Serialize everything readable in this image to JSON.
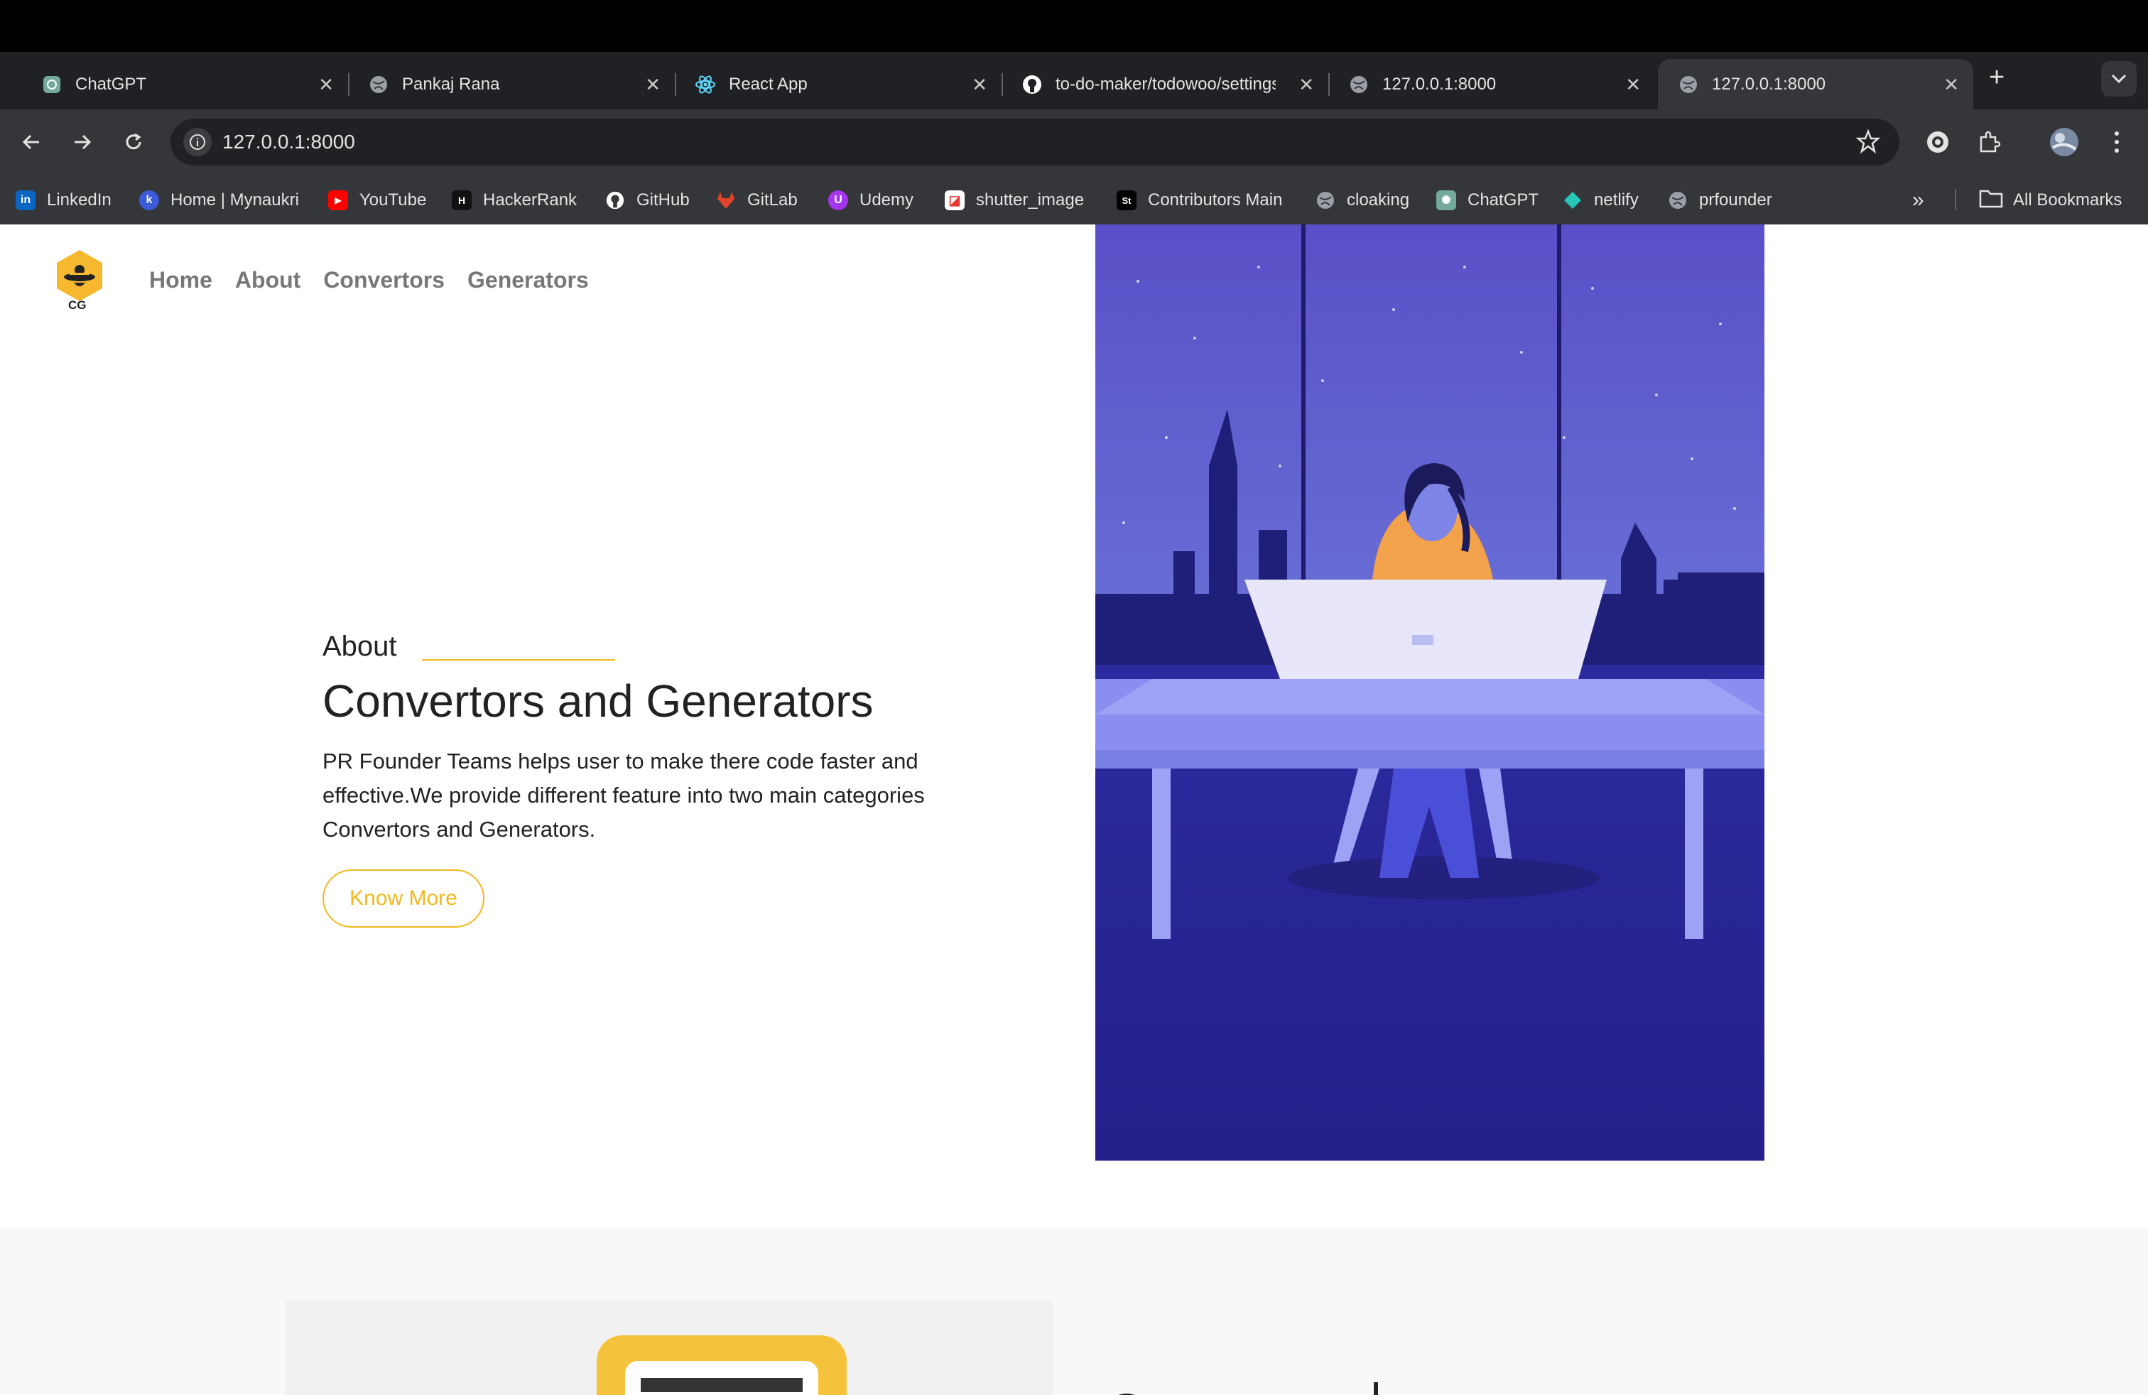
{
  "browser": {
    "tabs": [
      {
        "title": "ChatGPT",
        "icon": "chatgpt-icon",
        "active": false
      },
      {
        "title": "Pankaj Rana",
        "icon": "globe-icon",
        "active": false
      },
      {
        "title": "React App",
        "icon": "react-icon",
        "active": false
      },
      {
        "title": "to-do-maker/todowoo/settings",
        "icon": "github-icon",
        "active": false
      },
      {
        "title": "127.0.0.1:8000",
        "icon": "globe-icon",
        "active": false
      },
      {
        "title": "127.0.0.1:8000",
        "icon": "globe-icon",
        "active": true
      }
    ],
    "url": "127.0.0.1:8000",
    "bookmarks": [
      {
        "label": "LinkedIn",
        "icon": "linkedin-icon",
        "color": "#0a66c2",
        "glyph": "in"
      },
      {
        "label": "Home | Mynaukri",
        "icon": "mynaukri-icon",
        "color": "#3b5bdb",
        "glyph": "k"
      },
      {
        "label": "YouTube",
        "icon": "youtube-icon",
        "color": "#ff0000",
        "glyph": "▶"
      },
      {
        "label": "HackerRank",
        "icon": "hackerrank-icon",
        "color": "#111111",
        "glyph": "H"
      },
      {
        "label": "GitHub",
        "icon": "github-icon",
        "color": "#35363a",
        "glyph": "●"
      },
      {
        "label": "GitLab",
        "icon": "gitlab-icon",
        "color": "#e24329",
        "glyph": "◆"
      },
      {
        "label": "Udemy",
        "icon": "udemy-icon",
        "color": "#a435f0",
        "glyph": "U"
      },
      {
        "label": "shutter_image",
        "icon": "shutter-icon",
        "color": "#ffffff",
        "glyph": "◪"
      },
      {
        "label": "Contributors Main",
        "icon": "contributors-icon",
        "color": "#000000",
        "glyph": "St"
      },
      {
        "label": "cloaking",
        "icon": "globe-icon",
        "color": "#35363a",
        "glyph": "◍"
      },
      {
        "label": "ChatGPT",
        "icon": "chatgpt-icon",
        "color": "#74aa9c",
        "glyph": "✺"
      },
      {
        "label": "netlify",
        "icon": "netlify-icon",
        "color": "#25c7b7",
        "glyph": "◆"
      },
      {
        "label": "prfounder",
        "icon": "globe-icon",
        "color": "#35363a",
        "glyph": "◍"
      }
    ],
    "all_bookmarks_label": "All Bookmarks"
  },
  "site": {
    "logo_text": "CG",
    "nav": [
      "Home",
      "About",
      "Convertors",
      "Generators"
    ],
    "hero": {
      "eyebrow": "About",
      "title": "Convertors and Generators",
      "description": "PR Founder Teams helps user to make there code faster and effective.We provide different feature into two main categories Convertors and Generators.",
      "button": "Know More"
    },
    "accent_color": "#f2b91e",
    "illustration_colors": {
      "sky": "#5a4fc7",
      "desk": "#8a8ef0",
      "floor": "#2c2aa0"
    }
  }
}
